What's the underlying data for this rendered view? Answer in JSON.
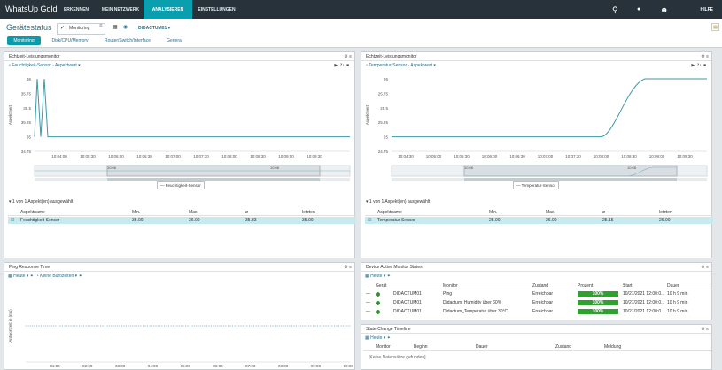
{
  "topbar": {
    "logo": "WhatsUp Gold",
    "nav": [
      "ERKENNEN",
      "MEIN NETZWERK",
      "ANALYSIEREN",
      "EINSTELLUNGEN"
    ],
    "active": "ANALYSIEREN",
    "help": "HILFE"
  },
  "subheader": {
    "title": "Gerätestatus",
    "monitor_select": "Monitoring",
    "device_select": "DIDACTUM01"
  },
  "tabs": [
    "Monitoring",
    "Disk/CPU/Memory",
    "Router/Switch/Interface",
    "General"
  ],
  "left_panel": {
    "title": "Echtzeit-Leistungsmonitor",
    "sensor": "Feuchtigkeit-Sensor - Aspektwert",
    "ylabel": "Aspektwert",
    "legend": "Feuchtigkeit-Sensor",
    "count": "1 von 1 Aspekt(en) ausgewählt",
    "columns": [
      "Aspektname",
      "Min.",
      "Max.",
      "ø",
      "letzten"
    ],
    "row": [
      "Feuchtigkeit-Sensor",
      "35.00",
      "36.00",
      "35.33",
      "35.00"
    ]
  },
  "right_panel": {
    "title": "Echtzeit-Leistungsmonitor",
    "sensor": "Temperatur-Sensor - Aspektwert",
    "ylabel": "Aspektwert",
    "legend": "Temperatur-Sensor",
    "count": "1 von 1 Aspekt(en) ausgewählt",
    "columns": [
      "Aspektname",
      "Min.",
      "Max.",
      "ø",
      "letzten"
    ],
    "row": [
      "Temperatur-Sensor",
      "25.00",
      "26.00",
      "25.15",
      "26.00"
    ]
  },
  "ping_panel": {
    "title": "Ping Response Time",
    "range": "Heute",
    "business_hours": "Keine Bürozeiten",
    "ylabel": "Antwortzeit in (ms)"
  },
  "states_panel": {
    "title": "Device Active Monitor States",
    "range": "Heute",
    "columns": [
      "Gerät",
      "Monitor",
      "Zustand",
      "Prozent",
      "Start",
      "Dauer"
    ],
    "rows": [
      {
        "device": "DIDACTUM01",
        "monitor": "Ping",
        "state": "Erreichbar",
        "percent": "100%",
        "start": "10/27/2021 12:00:0...",
        "duration": "10 h 9 min"
      },
      {
        "device": "DIDACTUM01",
        "monitor": "Didactum_Humidity über 60%",
        "state": "Erreichbar",
        "percent": "100%",
        "start": "10/27/2021 12:00:0...",
        "duration": "10 h 9 min"
      },
      {
        "device": "DIDACTUM01",
        "monitor": "Didactum_Temperatur über 30°C",
        "state": "Erreichbar",
        "percent": "100%",
        "start": "10/27/2021 12:00:0...",
        "duration": "10 h 9 min"
      }
    ]
  },
  "timeline_panel": {
    "title": "State Change Timeline",
    "range": "Heute",
    "columns": [
      "Monitor",
      "Beginn",
      "Dauer",
      "Zustand",
      "Meldung"
    ],
    "empty": "[Keine Datensätze gefunden]"
  },
  "chart_data": [
    {
      "type": "line",
      "title": "",
      "xlabel": "",
      "ylabel": "Aspektwert",
      "x": [
        "10:04:00",
        "10:05:30",
        "10:06:00",
        "10:06:30",
        "10:07:00",
        "10:07:30",
        "10:08:00",
        "10:08:30",
        "10:09:00",
        "10:09:30"
      ],
      "yticks": [
        "36",
        "35.75",
        "35.5",
        "35.25",
        "35",
        "34.75"
      ],
      "ylim": [
        34.75,
        36
      ],
      "series": [
        {
          "name": "Feuchtigkeit-Sensor",
          "values": [
            35,
            36,
            35,
            36,
            35,
            35,
            35,
            35,
            35,
            35,
            35,
            35
          ]
        }
      ],
      "navigator": [
        "10:06",
        "10:08"
      ]
    },
    {
      "type": "line",
      "title": "",
      "xlabel": "",
      "ylabel": "Aspektwert",
      "x": [
        "10:04:30",
        "10:05:00",
        "10:05:30",
        "10:06:00",
        "10:06:30",
        "10:07:00",
        "10:07:30",
        "10:08:00",
        "10:08:30",
        "10:09:00",
        "10:09:30"
      ],
      "yticks": [
        "26",
        "25.75",
        "25.5",
        "25.25",
        "25",
        "24.75"
      ],
      "ylim": [
        24.75,
        26
      ],
      "series": [
        {
          "name": "Temperatur-Sensor",
          "values": [
            25,
            25,
            25,
            25,
            25,
            25,
            25,
            25.05,
            25.5,
            25.9,
            26,
            26
          ]
        }
      ],
      "navigator": [
        "10:06",
        "10:08"
      ]
    },
    {
      "type": "line",
      "title": "",
      "xlabel": "",
      "ylabel": "Antwortzeit in (ms)",
      "x": [
        "01:00",
        "02:00",
        "03:00",
        "04:00",
        "05:00",
        "06:00",
        "07:00",
        "08:00",
        "09:00",
        "10:00"
      ],
      "series": [
        {
          "name": "Ping",
          "values": []
        }
      ]
    }
  ]
}
